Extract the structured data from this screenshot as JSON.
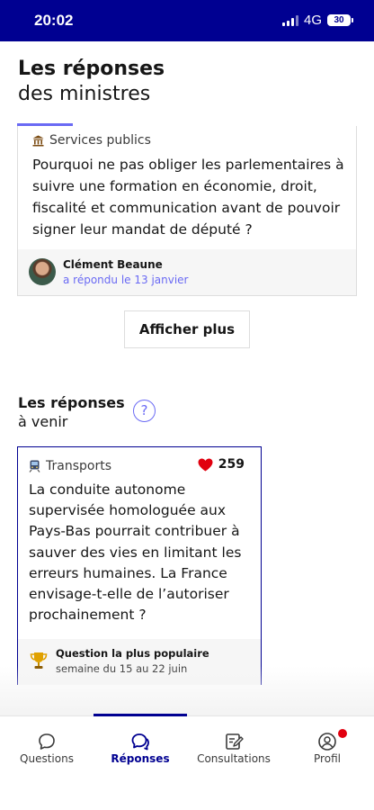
{
  "status_bar": {
    "time": "20:02",
    "network": "4G",
    "battery": "30"
  },
  "answers_section": {
    "title_bold": "Les réponses",
    "title_rest": "des ministres"
  },
  "answer_card": {
    "theme": "Services publics",
    "theme_icon": "building-icon",
    "question": "Pourquoi ne pas obliger les parlementaires à suivre une formation en économie, droit, fiscalité et communication avant de pouvoir signer leur mandat de député ?",
    "author": "Clément Beaune",
    "answered": "a répondu le 13 janvier"
  },
  "more_button": "Afficher plus",
  "upcoming_section": {
    "title_bold": "Les réponses",
    "title_rest": "à venir"
  },
  "question_card": {
    "theme": "Transports",
    "theme_icon": "train-icon",
    "likes": "259",
    "question": "La conduite autonome supervisée homologuée aux Pays-Bas pourrait contribuer à sauver des vies en limitant les erreurs humaines. La France envisage-t-elle de l’autoriser prochainement ?",
    "popular_label": "Question la plus populaire",
    "week": "semaine du 15 au 22 juin"
  },
  "tabs": [
    {
      "label": "Questions",
      "icon": "chat-bubble-icon",
      "active": false
    },
    {
      "label": "Réponses",
      "icon": "chat-bubbles-icon",
      "active": true
    },
    {
      "label": "Consultations",
      "icon": "edit-note-icon",
      "active": false
    },
    {
      "label": "Profil",
      "icon": "user-icon",
      "active": false
    }
  ],
  "colors": {
    "brand": "#000091",
    "accent": "#6a6af4",
    "like": "#e1000f"
  }
}
